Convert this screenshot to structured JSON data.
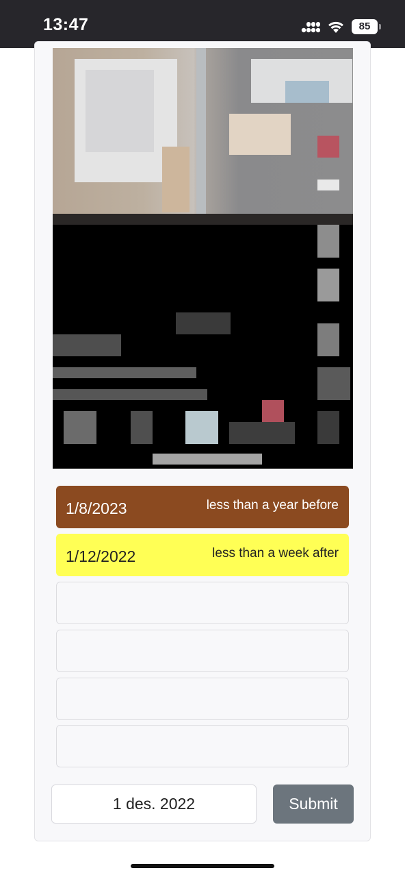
{
  "status_bar": {
    "time": "13:47",
    "battery": "85",
    "icons": [
      "signal-icon",
      "wifi-icon",
      "battery-icon"
    ]
  },
  "photo": {
    "description_icon": "pixelated-photo"
  },
  "guesses": [
    {
      "date": "1/8/2023",
      "hint": "less than a year before",
      "color": "#8b4a20",
      "text_color": "#ffffff"
    },
    {
      "date": "1/12/2022",
      "hint": "less than a week after",
      "color": "#ffff55",
      "text_color": "#222222"
    },
    {
      "date": "",
      "hint": "",
      "color": "#f8f8fa",
      "text_color": "#222222"
    },
    {
      "date": "",
      "hint": "",
      "color": "#f8f8fa",
      "text_color": "#222222"
    },
    {
      "date": "",
      "hint": "",
      "color": "#f8f8fa",
      "text_color": "#222222"
    },
    {
      "date": "",
      "hint": "",
      "color": "#f8f8fa",
      "text_color": "#222222"
    }
  ],
  "form": {
    "date_value": "1 des. 2022",
    "submit_label": "Submit"
  },
  "colors": {
    "status_bar_bg": "#27262b",
    "submit_bg": "#6c757d"
  }
}
